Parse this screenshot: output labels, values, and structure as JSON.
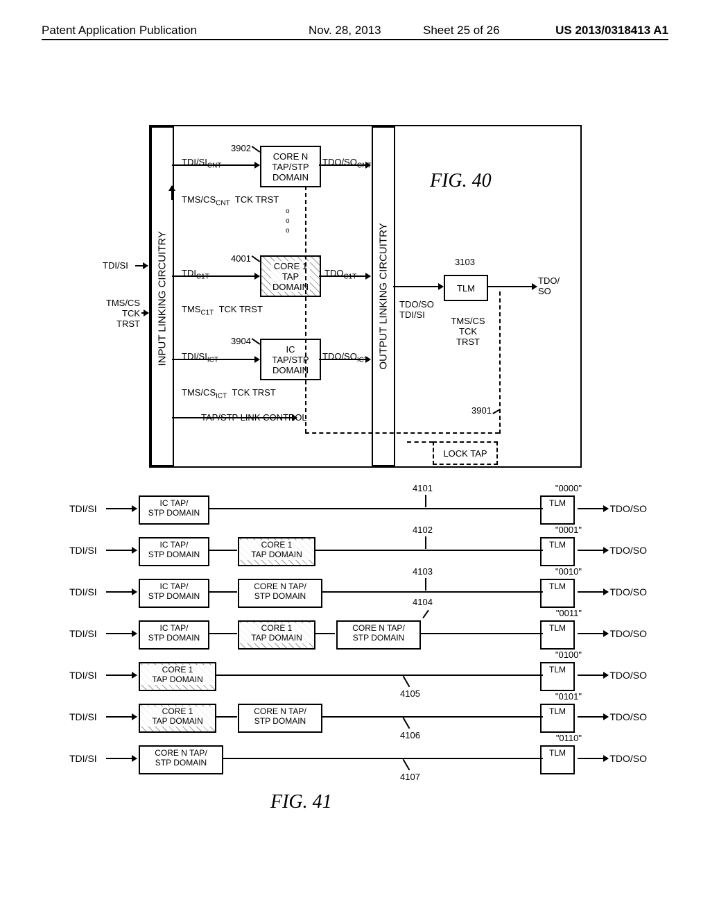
{
  "header": {
    "publication": "Patent Application Publication",
    "date": "Nov. 28, 2013",
    "sheet": "Sheet 25 of 26",
    "pubno": "US 2013/0318413 A1"
  },
  "fig40": {
    "title": "FIG.  40",
    "input_block": "INPUT LINKING CIRCUITRY",
    "output_block": "OUTPUT LINKING CIRCUITRY",
    "ext_inputs": "TDI/SI",
    "ext_inputs2": "TMS/CS\nTCK\nTRST",
    "ext_output": "TDO/\nSO",
    "tlm": {
      "ref": "3103",
      "label": "TLM",
      "sig_below": "TDO/SO\nTDI/SI",
      "sig_right": "TMS/CS\nTCK\nTRST"
    },
    "lock_tap": "LOCK TAP",
    "ref3901": "3901",
    "link_control": "TAP/STP LINK CONTROL",
    "coreN": {
      "ref": "3902",
      "tdi": "TDI/SI",
      "tdi_sub": "CNT",
      "label": "CORE N\nTAP/STP\nDOMAIN",
      "tdo": "TDO/SO",
      "tdo_sub": "CNT",
      "tms": "TMS/CS",
      "tms_sub": "CNT",
      "rest": "TCK  TRST"
    },
    "core1": {
      "ref": "4001",
      "tdi": "TDI",
      "tdi_sub": "C1T",
      "label": "CORE 1\nTAP\nDOMAIN",
      "tdo": "TDO",
      "tdo_sub": "C1T",
      "tms": "TMS",
      "tms_sub": "C1T",
      "rest": "TCK  TRST"
    },
    "ic": {
      "ref": "3904",
      "tdi": "TDI/SI",
      "tdi_sub": "ICT",
      "label": "IC\nTAP/STP\nDOMAIN",
      "tdo": "TDO/SO",
      "tdo_sub": "ICT",
      "tms": "TMS/CS",
      "tms_sub": "ICT",
      "rest": "TCK  TRST"
    }
  },
  "fig41": {
    "title": "FIG.  41",
    "in": "TDI/SI",
    "out": "TDO/SO",
    "ic": "IC TAP/\nSTP DOMAIN",
    "core1": "CORE 1\nTAP DOMAIN",
    "coreN": "CORE N TAP/\nSTP DOMAIN",
    "tlm": "TLM",
    "rows": [
      {
        "ref": "4101",
        "code": "\"0000\""
      },
      {
        "ref": "4102",
        "code": "\"0001\""
      },
      {
        "ref": "4103",
        "code": "\"0010\""
      },
      {
        "ref": "4104",
        "code": "\"0011\""
      },
      {
        "ref": "4105",
        "code": "\"0100\""
      },
      {
        "ref": "4106",
        "code": "\"0101\""
      },
      {
        "ref": "4107",
        "code": "\"0110\""
      }
    ]
  }
}
